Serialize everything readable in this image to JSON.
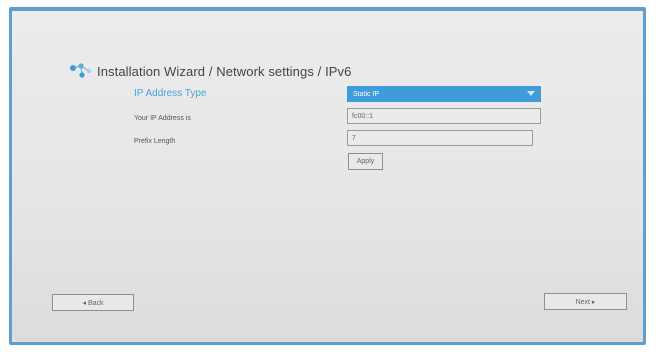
{
  "wizard": {
    "title": "Installation Wizard / Network settings / IPv6"
  },
  "form": {
    "ip_type_label": "IP Address Type",
    "ip_type_value": "Static IP",
    "ip_address_label": "Your IP Address is",
    "ip_address_value": "fc00::1",
    "prefix_label": "Prefix Length",
    "prefix_value": "7",
    "apply_label": "Apply"
  },
  "footer": {
    "back_label": "◂ Back",
    "next_label": "Next ▸"
  },
  "colors": {
    "accent": "#3e9dd8",
    "frame": "#5e9ed2"
  },
  "icons": {
    "title": "network-nodes-icon",
    "dropdown": "dropdown-arrow-icon"
  }
}
